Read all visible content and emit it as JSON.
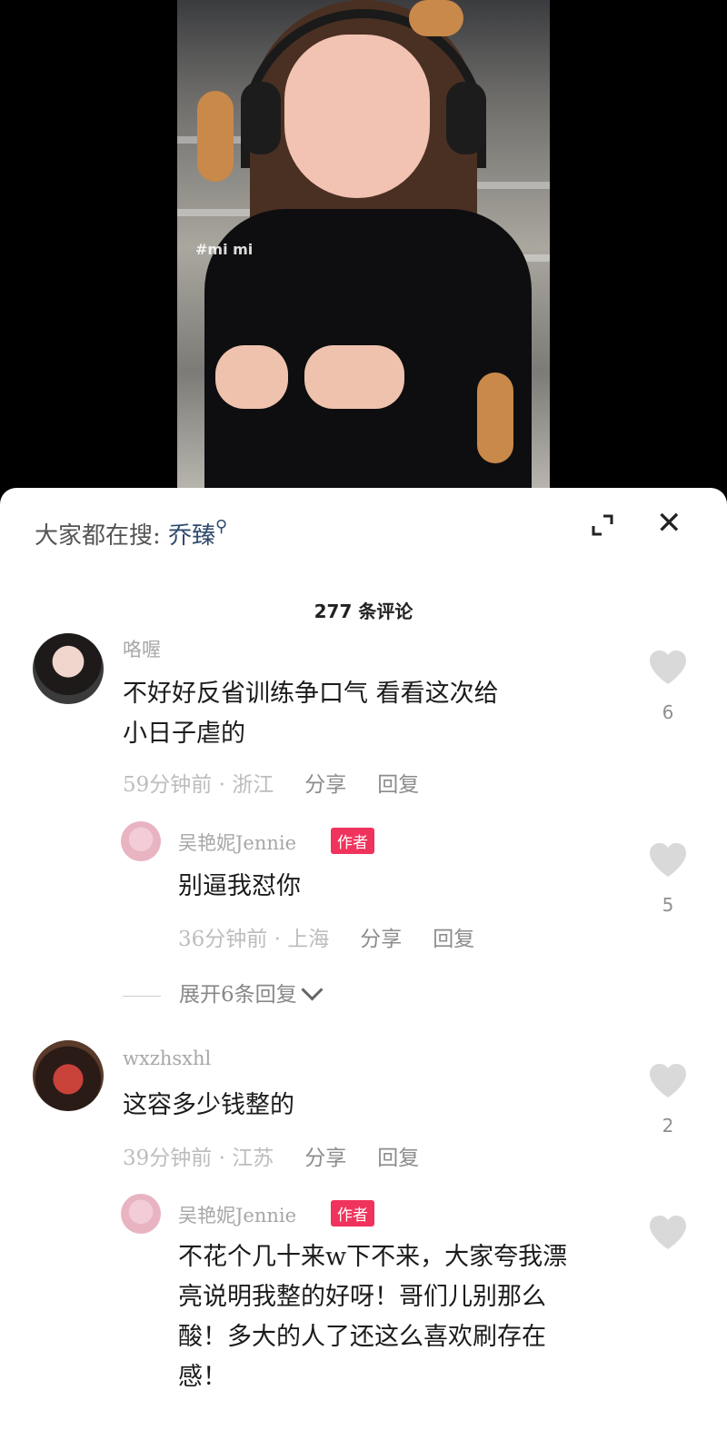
{
  "video": {
    "overlay_tag": "#mi mi"
  },
  "search": {
    "prefix": "大家都在搜:",
    "term": "乔臻"
  },
  "comments_header": {
    "count_label": "277 条评论"
  },
  "comments": [
    {
      "username": "咯喔",
      "text_lines": [
        "不好好反省训练争口气  看看这次给",
        "小日子虐的"
      ],
      "time": "59分钟前",
      "location": "浙江",
      "share": "分享",
      "reply": "回复",
      "likes": "6"
    },
    {
      "username": "吴艳妮Jennie",
      "badge": "作者",
      "text_lines": [
        "别逼我怼你"
      ],
      "time": "36分钟前",
      "location": "上海",
      "share": "分享",
      "reply": "回复",
      "likes": "5"
    },
    {
      "expand_label": "展开6条回复"
    },
    {
      "username": "wxzhsxhl",
      "text_lines": [
        "这容多少钱整的"
      ],
      "time": "39分钟前",
      "location": "江苏",
      "share": "分享",
      "reply": "回复",
      "likes": "2"
    },
    {
      "username": "吴艳妮Jennie",
      "badge": "作者",
      "text_lines": [
        "不花个几十来w下不来，大家夸我漂",
        "亮说明我整的好呀！哥们儿别那么",
        "酸！多大的人了还这么喜欢刷存在",
        "感！"
      ]
    }
  ],
  "colors": {
    "badge": "#f0335c",
    "search_term": "#2f4a6e"
  }
}
